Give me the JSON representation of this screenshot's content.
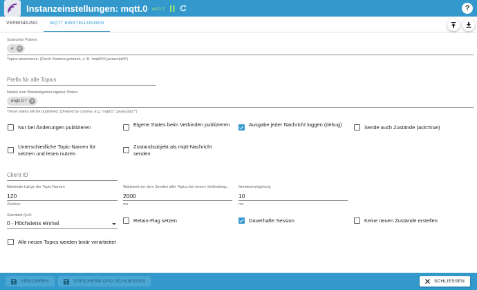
{
  "header": {
    "title": "Instanzeinstellungen: mqtt.0",
    "version": "v4.0.7",
    "help_label": "?"
  },
  "tabs": [
    {
      "label": "Verbindung",
      "active": false
    },
    {
      "label": "MQTT Einstellungen",
      "active": true
    }
  ],
  "form": {
    "subscribe": {
      "label": "Subscribe Pattern",
      "chips": [
        "#"
      ],
      "help": "Topics abonnieren. (Durch Komma getrennt, z. B. 'mqtt/0/#,javascript/#')"
    },
    "prefix": {
      "placeholder": "Prefix für alle Topics",
      "value": ""
    },
    "mask": {
      "label": "Maske zum Bekanntgeben eigener States",
      "chips": [
        "mqtt.0.*"
      ],
      "help": "These states will be published. (Divided by comma, e.g. 'mqtt.0.*,javascript.*')"
    },
    "checkboxes_row1": [
      {
        "label": "Nur bei Änderungen publizieren",
        "checked": false
      },
      {
        "label": "Eigene States beim Verbinden publizieren",
        "checked": false
      },
      {
        "label": "Ausgabe jeder Nachricht loggen (debug)",
        "checked": true
      },
      {
        "label": "Sende auch Zustände (ack=true)",
        "checked": false
      }
    ],
    "checkboxes_row2": [
      {
        "label": "Unterschiedliche Topic-Namen für setzten und lesen nutzen",
        "checked": false
      },
      {
        "label": "Zustandsobjekt als mqtt-Nachricht senden",
        "checked": false
      }
    ],
    "client_id": {
      "placeholder": "Client ID",
      "value": ""
    },
    "max_topic_length": {
      "label": "Maximale Länge der Topic-Namen",
      "value": "120",
      "unit": "Zeichen"
    },
    "wait_time": {
      "label": "Wartezeit vor dem Senden aller Topics bei neuen Verbindung...",
      "value": "2000",
      "unit": "ms"
    },
    "send_delay": {
      "label": "Sendeverzögerung",
      "value": "10",
      "unit": "ms"
    },
    "qos": {
      "label": "Standard-QoS:",
      "value": "0 - Höchstens einmal"
    },
    "checkboxes_row3": [
      {
        "label": "Retain-Flag setzen",
        "checked": false
      },
      {
        "label": "Dauerhafte Session",
        "checked": true
      },
      {
        "label": "Keine neuen Zustände erstellen",
        "checked": false
      }
    ],
    "binary": {
      "label": "Alle neuen Topics werden binär verarbeitet",
      "checked": false
    }
  },
  "footer": {
    "save_label": "SPEICHERN",
    "save_close_label": "SPEICHERN UND SCHLIESSEN",
    "close_label": "SCHLIESSEN"
  },
  "colors": {
    "primary": "#3399cc",
    "version": "#9fe870"
  }
}
